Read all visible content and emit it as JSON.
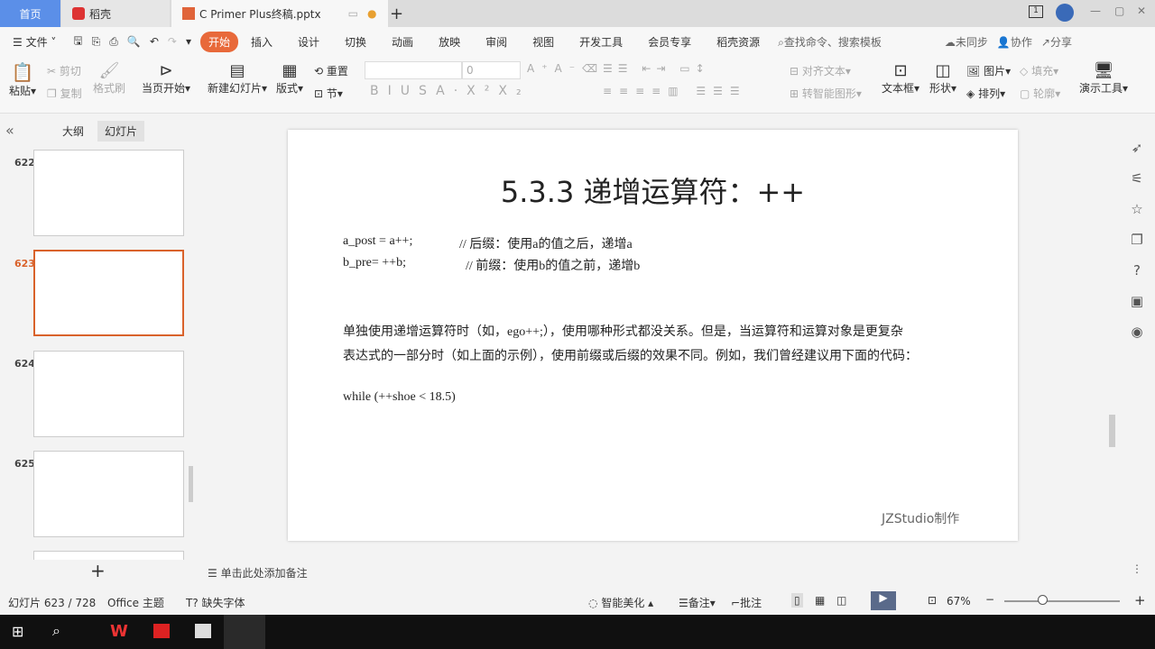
{
  "tabs": [
    {
      "label": "首页"
    },
    {
      "label": "稻壳"
    },
    {
      "label": "C Primer  Plus终稿.pptx"
    }
  ],
  "window": {
    "badge": "1"
  },
  "menu": {
    "file": "文件",
    "items": [
      "开始",
      "插入",
      "设计",
      "切换",
      "动画",
      "放映",
      "审阅",
      "视图",
      "开发工具",
      "会员专享",
      "稻壳资源"
    ],
    "search_placeholder": "查找命令、搜索模板",
    "sync": "未同步",
    "collab": "协作",
    "share": "分享"
  },
  "ribbon": {
    "paste": "粘贴",
    "cut": "剪切",
    "copy": "复制",
    "format_painter": "格式刷",
    "play_from_current": "当页开始",
    "new_slide": "新建幻灯片",
    "layout": "版式",
    "section": "节",
    "reset": "重置",
    "font_size": "0",
    "align_text": "对齐文本",
    "smartart": "转智能图形",
    "textbox": "文本框",
    "shape": "形状",
    "picture": "图片",
    "arrange": "排列",
    "fill": "填充",
    "outline": "轮廓",
    "present_tools": "演示工具"
  },
  "left": {
    "tab_outline": "大纲",
    "tab_slides": "幻灯片",
    "thumbs": [
      {
        "num": "622"
      },
      {
        "num": "623"
      },
      {
        "num": "624"
      },
      {
        "num": "625"
      }
    ]
  },
  "slide": {
    "title": "5.3.3 递增运算符：++",
    "code1": "a_post = a++;",
    "comment1": "// 后缀：使用a的值之后，递增a",
    "code2": "b_pre= ++b;",
    "comment2": "// 前缀：使用b的值之前，递增b",
    "para1": "单独使用递增运算符时（如，ego++;），使用哪种形式都没关系。但是，当运算符和运算对象是更复杂",
    "para2": "表达式的一部分时（如上面的示例），使用前缀或后缀的效果不同。例如，我们曾经建议用下面的代码：",
    "code3": "while (++shoe < 18.5)",
    "footer": "JZStudio制作"
  },
  "notes": {
    "placeholder": "单击此处添加备注"
  },
  "status": {
    "slide_count": "幻灯片 623 / 728",
    "theme": "Office 主题",
    "missing_font": "缺失字体",
    "beautify": "智能美化",
    "notes": "备注",
    "comments": "批注",
    "zoom": "67%"
  },
  "colors": {
    "accent": "#e8693a",
    "selected_border": "#d9622b"
  }
}
